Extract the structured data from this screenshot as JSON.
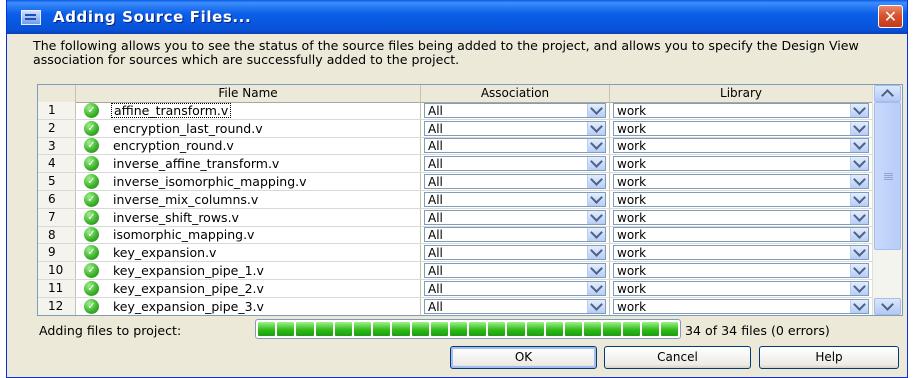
{
  "window": {
    "title": "Adding Source Files...",
    "close_glyph": "✕",
    "description": "The following allows you to see the status of the source files being added to the project, and allows you to specify the Design View association for sources which are successfully added to the project."
  },
  "table": {
    "columns": [
      "",
      "File Name",
      "Association",
      "Library"
    ],
    "rows": [
      {
        "num": "1",
        "file": "affine_transform.v",
        "association": "All",
        "library": "work"
      },
      {
        "num": "2",
        "file": "encryption_last_round.v",
        "association": "All",
        "library": "work"
      },
      {
        "num": "3",
        "file": "encryption_round.v",
        "association": "All",
        "library": "work"
      },
      {
        "num": "4",
        "file": "inverse_affine_transform.v",
        "association": "All",
        "library": "work"
      },
      {
        "num": "5",
        "file": "inverse_isomorphic_mapping.v",
        "association": "All",
        "library": "work"
      },
      {
        "num": "6",
        "file": "inverse_mix_columns.v",
        "association": "All",
        "library": "work"
      },
      {
        "num": "7",
        "file": "inverse_shift_rows.v",
        "association": "All",
        "library": "work"
      },
      {
        "num": "8",
        "file": "isomorphic_mapping.v",
        "association": "All",
        "library": "work"
      },
      {
        "num": "9",
        "file": "key_expansion.v",
        "association": "All",
        "library": "work"
      },
      {
        "num": "10",
        "file": "key_expansion_pipe_1.v",
        "association": "All",
        "library": "work"
      },
      {
        "num": "11",
        "file": "key_expansion_pipe_2.v",
        "association": "All",
        "library": "work"
      },
      {
        "num": "12",
        "file": "key_expansion_pipe_3.v",
        "association": "All",
        "library": "work"
      }
    ],
    "status_icon": "check-circle-icon"
  },
  "progress": {
    "label": "Adding files to project:",
    "fraction": 1.0,
    "status": "34 of 34 files (0 errors)"
  },
  "buttons": {
    "ok": "OK",
    "cancel": "Cancel",
    "help": "Help"
  },
  "colors": {
    "titlebar": "#0b5fe9",
    "success": "#3fb52d",
    "progress": "#2fbc1c",
    "close": "#d8532d"
  }
}
